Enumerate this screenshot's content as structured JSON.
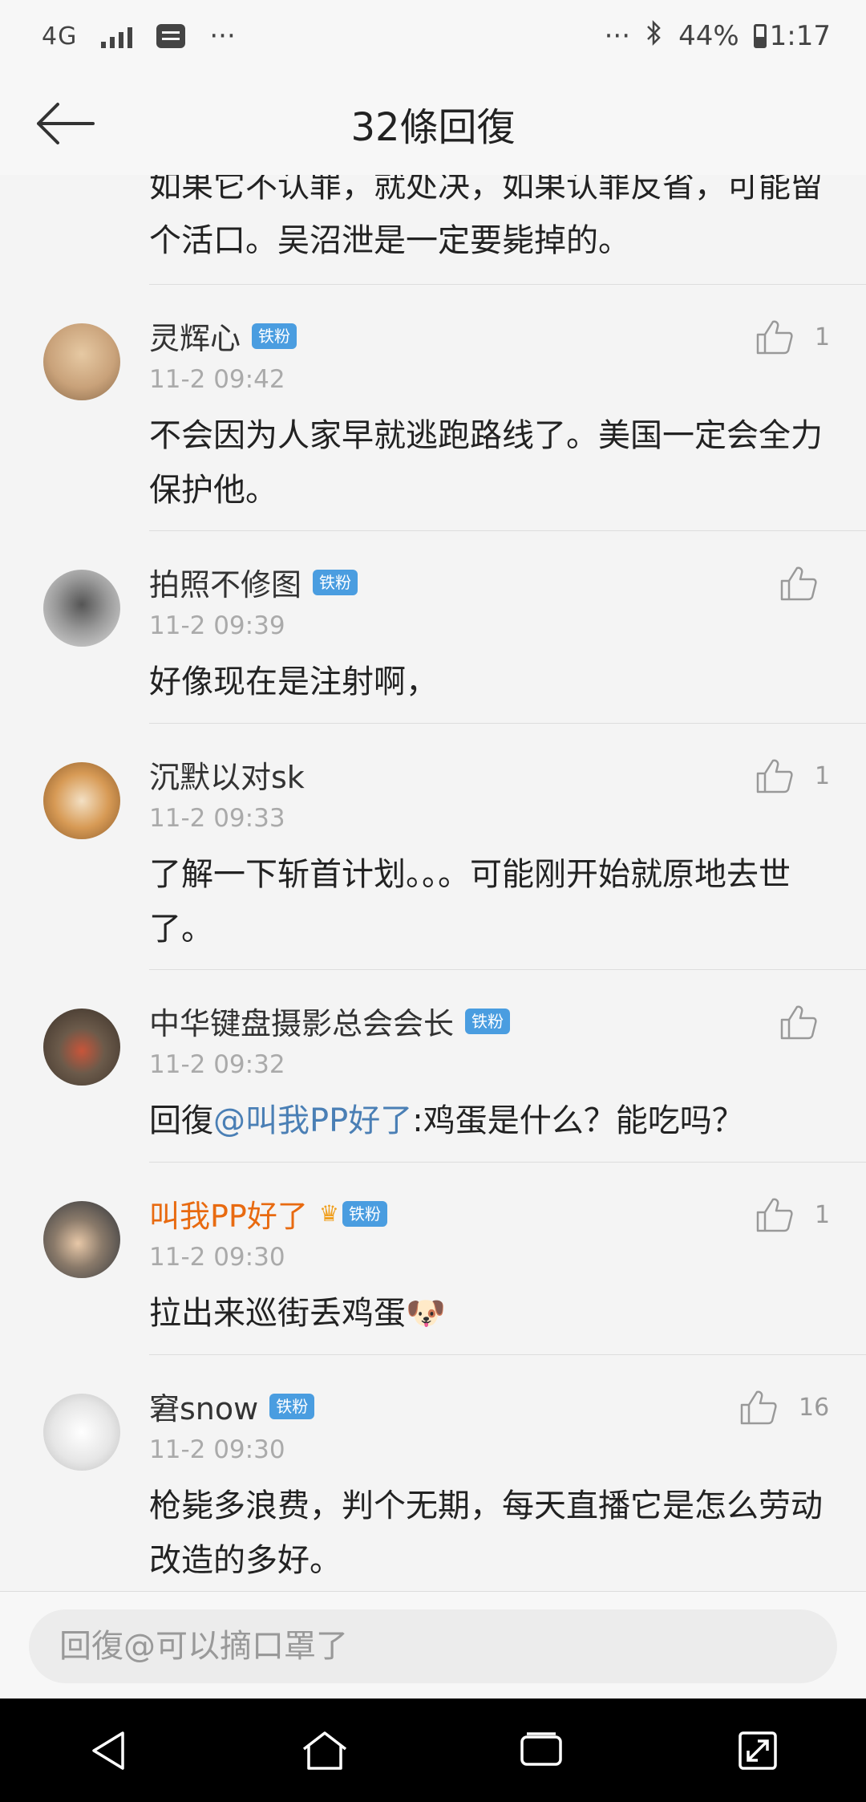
{
  "status_bar": {
    "network": "4G",
    "left_more": "···",
    "right_more": "···",
    "battery": "44%",
    "time": "1:17"
  },
  "header": {
    "title": "32條回復"
  },
  "partial_comment": {
    "text": "如果它不认罪，就处决，如果认罪反省，可能留个活口。吴沼泄是一定要毙掉的。"
  },
  "comments": [
    {
      "name": "灵辉心",
      "badge": "铁粉",
      "time": "11-2 09:42",
      "text": "不会因为人家早就逃跑路线了。美国一定会全力保护他。",
      "likes": "1",
      "avatar_color": "#c9a27a"
    },
    {
      "name": "拍照不修图",
      "badge": "铁粉",
      "time": "11-2 09:39",
      "text": "好像现在是注射啊，",
      "likes": "",
      "avatar_color": "#bdbdbd"
    },
    {
      "name": "沉默以对sk",
      "badge": "",
      "time": "11-2 09:33",
      "text": "了解一下斩首计划。。。可能刚开始就原地去世了。",
      "likes": "1",
      "avatar_color": "#d79a55"
    },
    {
      "name": "中华键盘摄影总会会长",
      "badge": "铁粉",
      "time": "11-2 09:32",
      "reply_prefix": "回復",
      "mention": "@叫我PP好了",
      "text": ":鸡蛋是什么？能吃吗？",
      "likes": "",
      "avatar_color": "#6b5a4a"
    },
    {
      "name": "叫我PP好了",
      "badge": "铁粉",
      "crown": "♛",
      "time": "11-2 09:30",
      "text": "拉出来巡街丢鸡蛋",
      "emoji": "🐶",
      "likes": "1",
      "avatar_color": "#5a6470"
    },
    {
      "name": "窘snow",
      "badge": "铁粉",
      "time": "11-2 09:30",
      "text": "枪毙多浪费，判个无期，每天直播它是怎么劳动改造的多好。",
      "likes": "16",
      "avatar_color": "#e0e0e0"
    }
  ],
  "reply_bar": {
    "placeholder": "回復@可以摘口罩了"
  },
  "nav_bar": {
    "buttons": [
      "back",
      "home",
      "recents",
      "expand"
    ]
  }
}
